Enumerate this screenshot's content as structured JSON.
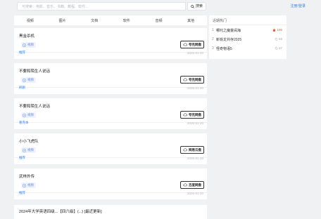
{
  "header": {
    "search_placeholder": "可搜索：电影、音乐、书籍、教程、软件...",
    "search_label": "搜索",
    "login_label": "注册/登录"
  },
  "tabs": [
    "视频",
    "图片",
    "文档",
    "软件",
    "音频",
    "其他"
  ],
  "resources": [
    {
      "title": "黑金杀机",
      "type": "视频",
      "pan": "夸克网盘",
      "category": "推荐",
      "date": "2026-01-20"
    },
    {
      "title": "不要和陌生人说话",
      "type": "视频",
      "pan": "夸克网盘",
      "category": "刷剧",
      "date": "2026-01-20"
    },
    {
      "title": "不要和陌生人说话",
      "type": "视频",
      "pan": "夸克网盘",
      "category": "看完本",
      "date": "2026-01-20"
    },
    {
      "title": "小小飞虎队",
      "type": "视频",
      "pan": "网易云盘",
      "category": "推荐",
      "date": "2026-01-20"
    },
    {
      "title": "武林外传",
      "type": "视频",
      "pan": "百度网盘",
      "category": "推荐",
      "date": "2026-01-20"
    }
  ],
  "partial_title": "2024年大学英语四级...【四六级】(...) [最近更新]",
  "hot": {
    "heading": "近期热门",
    "items": [
      {
        "rank": "1",
        "name": "哪吒之魔童闹海",
        "count": "186",
        "hot": true
      },
      {
        "rank": "2",
        "name": "新铁龙共存2025",
        "count": "69",
        "hot": false
      },
      {
        "rank": "3",
        "name": "怪奇物语5",
        "count": "67",
        "hot": false
      }
    ]
  },
  "colors": {
    "accent": "#2f80ed",
    "hot": "#e45c43",
    "background": "#f0f1f3"
  }
}
